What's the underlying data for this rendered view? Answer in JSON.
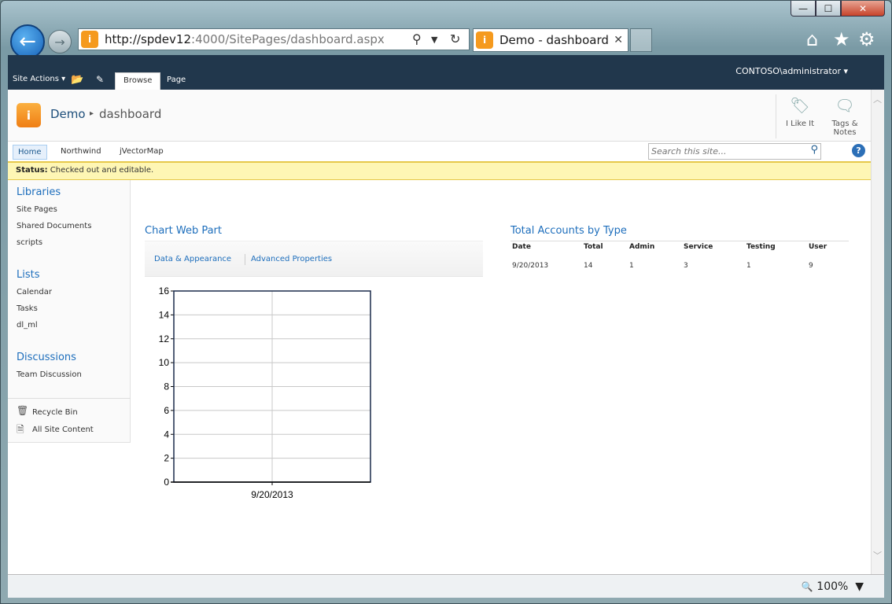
{
  "browser": {
    "url_host": "http://spdev12",
    "url_rest": ":4000/SitePages/dashboard.aspx",
    "tab_title": "Demo - dashboard",
    "zoom": "100%"
  },
  "ribbon": {
    "site_actions": "Site Actions",
    "tabs": [
      "Browse",
      "Page"
    ],
    "user": "CONTOSO\\administrator"
  },
  "title_area": {
    "site": "Demo",
    "page": "dashboard",
    "i_like_it": "I Like It",
    "tags_notes_1": "Tags &",
    "tags_notes_2": "Notes"
  },
  "top_nav": {
    "items": [
      "Home",
      "Northwind",
      "jVectorMap"
    ],
    "search_placeholder": "Search this site..."
  },
  "status": {
    "label": "Status:",
    "text": "Checked out and editable."
  },
  "left_nav": {
    "libraries": "Libraries",
    "library_items": [
      "Site Pages",
      "Shared Documents",
      "scripts"
    ],
    "lists": "Lists",
    "list_items": [
      "Calendar",
      "Tasks",
      "dl_ml"
    ],
    "discussions": "Discussions",
    "discussion_items": [
      "Team Discussion"
    ],
    "recycle_bin": "Recycle Bin",
    "all_site_content": "All Site Content"
  },
  "chart_web_part": {
    "title": "Chart Web Part",
    "links": [
      "Data & Appearance",
      "Advanced Properties"
    ]
  },
  "chart_data": {
    "type": "bar",
    "categories": [
      "9/20/2013"
    ],
    "values": [],
    "ylim": [
      0,
      16
    ],
    "yticks": [
      "0",
      "2",
      "4",
      "6",
      "8",
      "10",
      "12",
      "14",
      "16"
    ],
    "grid": true
  },
  "accounts": {
    "title": "Total Accounts by Type",
    "headers": [
      "Date",
      "Total",
      "Admin",
      "Service",
      "Testing",
      "User"
    ],
    "rows": [
      [
        "9/20/2013",
        "14",
        "1",
        "3",
        "1",
        "9"
      ]
    ]
  }
}
